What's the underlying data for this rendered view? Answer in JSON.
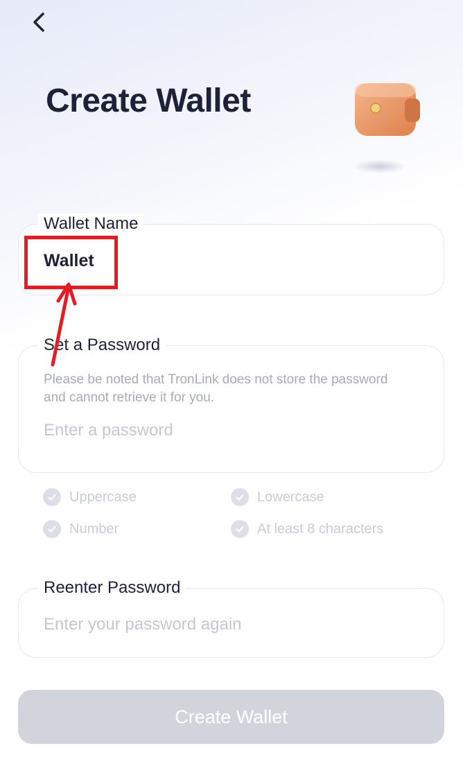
{
  "header": {
    "back_icon": "chevron-left-icon",
    "title": "Create Wallet",
    "illustration": "wallet-icon"
  },
  "wallet_name": {
    "label": "Wallet Name",
    "value": "Wallet"
  },
  "password": {
    "label": "Set a Password",
    "note": "Please be noted that TronLink does not store the password and cannot retrieve it for you.",
    "placeholder": "Enter a password",
    "rules": [
      {
        "label": "Uppercase",
        "icon": "check-circle-icon"
      },
      {
        "label": "Lowercase",
        "icon": "check-circle-icon"
      },
      {
        "label": "Number",
        "icon": "check-circle-icon"
      },
      {
        "label": "At least 8 characters",
        "icon": "check-circle-icon"
      }
    ]
  },
  "reenter": {
    "label": "Reenter Password",
    "placeholder": "Enter your password again"
  },
  "actions": {
    "create_label": "Create Wallet"
  },
  "colors": {
    "title": "#1d2238",
    "button_disabled": "#d2d4dc",
    "annotation": "#e31b23"
  }
}
